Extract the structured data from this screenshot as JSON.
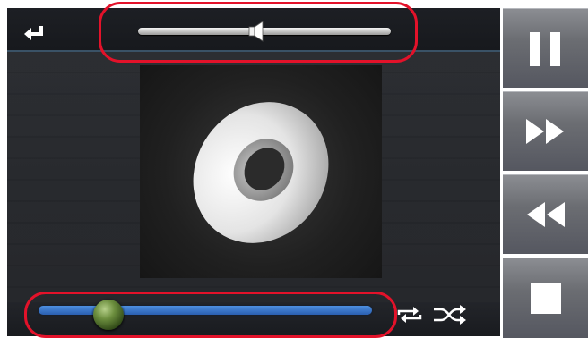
{
  "player": {
    "volume_level": 0.5,
    "seek_position": 0.17
  },
  "icons": {
    "back": "return-arrow-icon",
    "volume": "speaker-icon",
    "album": "disc-icon",
    "repeat": "repeat-icon",
    "shuffle": "shuffle-icon",
    "pause": "pause-icon",
    "fast_forward": "fast-forward-icon",
    "rewind": "rewind-icon",
    "stop": "stop-icon"
  },
  "colors": {
    "highlight": "#e3122a",
    "seek_fill": "#3b78cc",
    "knob": "#6c8e3e"
  }
}
